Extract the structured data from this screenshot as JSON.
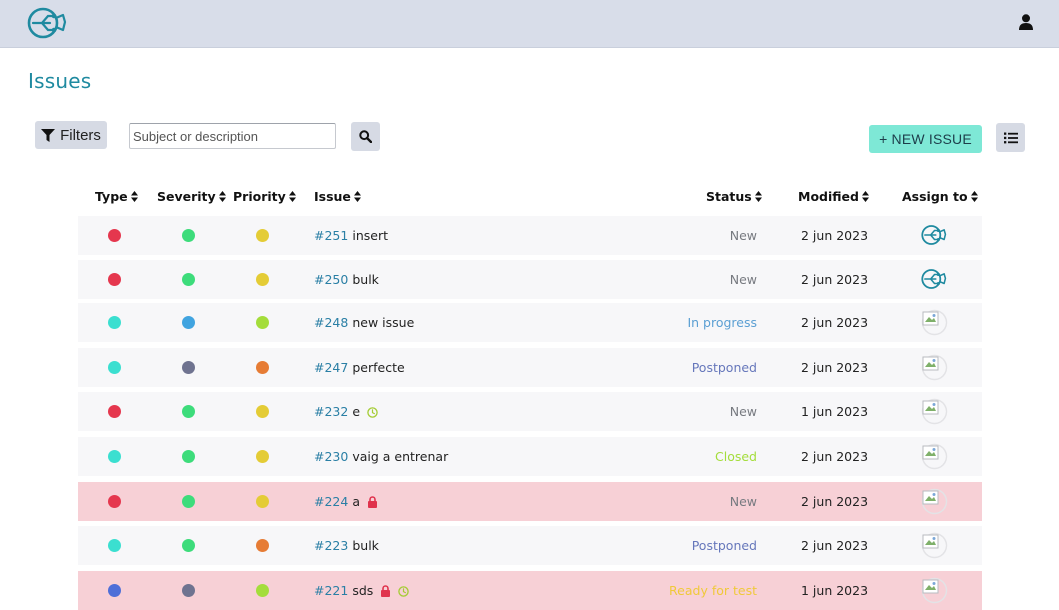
{
  "header": {
    "logo": "project-logo",
    "user_icon": "user-icon"
  },
  "page": {
    "title": "Issues"
  },
  "toolbar": {
    "filters_label": "Filters",
    "search_placeholder": "Subject or description",
    "new_issue_label": "+ NEW ISSUE"
  },
  "table": {
    "columns": [
      "Type",
      "Severity",
      "Priority",
      "Issue",
      "Status",
      "Modified",
      "Assign to"
    ],
    "rows": [
      {
        "type_color": "#e5374e",
        "severity_color": "#3ddc7b",
        "priority_color": "#e4cc36",
        "ref": "#251",
        "subject": "insert",
        "status": "New",
        "status_color": "#777a80",
        "modified": "2 jun 2023",
        "assignee": "project-logo",
        "blocked": false,
        "icons": []
      },
      {
        "type_color": "#e5374e",
        "severity_color": "#3ddc7b",
        "priority_color": "#e4cc36",
        "ref": "#250",
        "subject": "bulk",
        "status": "New",
        "status_color": "#777a80",
        "modified": "2 jun 2023",
        "assignee": "project-logo",
        "blocked": false,
        "icons": []
      },
      {
        "type_color": "#3bdfd0",
        "severity_color": "#41a4e0",
        "priority_color": "#a4dd3b",
        "ref": "#248",
        "subject": "new issue",
        "status": "In progress",
        "status_color": "#5b9fd3",
        "modified": "2 jun 2023",
        "assignee": "broken-avatar",
        "blocked": false,
        "icons": []
      },
      {
        "type_color": "#3bdfd0",
        "severity_color": "#6f7390",
        "priority_color": "#e67c35",
        "ref": "#247",
        "subject": "perfecte",
        "status": "Postponed",
        "status_color": "#6677bb",
        "modified": "2 jun 2023",
        "assignee": "broken-avatar",
        "blocked": false,
        "icons": []
      },
      {
        "type_color": "#e5374e",
        "severity_color": "#3ddc7b",
        "priority_color": "#e4cc36",
        "ref": "#232",
        "subject": "e",
        "status": "New",
        "status_color": "#777a80",
        "modified": "1 jun 2023",
        "assignee": "broken-avatar",
        "blocked": false,
        "icons": [
          "clock-icon"
        ]
      },
      {
        "type_color": "#3bdfd0",
        "severity_color": "#3ddc7b",
        "priority_color": "#e4cc36",
        "ref": "#230",
        "subject": "vaig a entrenar",
        "status": "Closed",
        "status_color": "#a4dd3b",
        "modified": "2 jun 2023",
        "assignee": "broken-avatar",
        "blocked": false,
        "icons": []
      },
      {
        "type_color": "#e5374e",
        "severity_color": "#3ddc7b",
        "priority_color": "#e4cc36",
        "ref": "#224",
        "subject": "a",
        "status": "New",
        "status_color": "#777a80",
        "modified": "2 jun 2023",
        "assignee": "broken-avatar",
        "blocked": true,
        "icons": [
          "lock-icon"
        ]
      },
      {
        "type_color": "#3bdfd0",
        "severity_color": "#3ddc7b",
        "priority_color": "#e67c35",
        "ref": "#223",
        "subject": "bulk",
        "status": "Postponed",
        "status_color": "#6677bb",
        "modified": "2 jun 2023",
        "assignee": "broken-avatar",
        "blocked": false,
        "icons": []
      },
      {
        "type_color": "#4e6fd8",
        "severity_color": "#6f7390",
        "priority_color": "#a4dd3b",
        "ref": "#221",
        "subject": "sds",
        "status": "Ready for test",
        "status_color": "#f0c93a",
        "modified": "1 jun 2023",
        "assignee": "broken-avatar",
        "blocked": true,
        "icons": [
          "lock-icon",
          "clock-icon"
        ]
      }
    ]
  },
  "colors": {
    "title": "#1f8aa0",
    "brand": "#1f8aa0",
    "new_issue_bg": "#7ee8d6",
    "topbar": "#d8dde9",
    "blocked_row": "#f7d0d6"
  }
}
